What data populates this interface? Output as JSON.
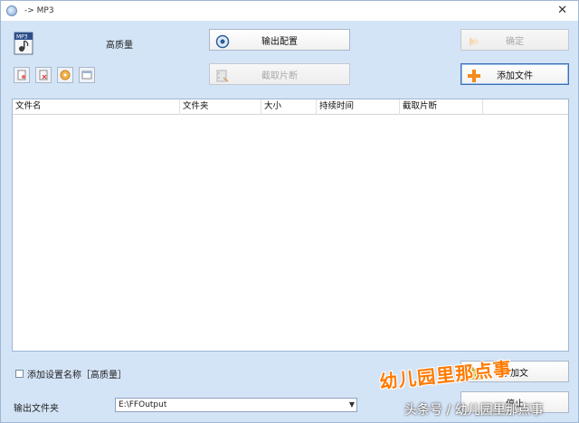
{
  "window": {
    "title": "-> MP3"
  },
  "header": {
    "quality_label": "高质量"
  },
  "buttons": {
    "output_config": "输出配置",
    "ok": "确定",
    "clip": "截取片断",
    "add_file": "添加文件",
    "add_file_bottom": "添加文",
    "stop": "停止"
  },
  "file_list": {
    "columns": [
      "文件名",
      "文件夹",
      "大小",
      "持续时间",
      "截取片断"
    ]
  },
  "options": {
    "add_setting_name_label": "添加设置名称［高质量］"
  },
  "output": {
    "folder_label": "输出文件夹",
    "folder_value": "E:\\FFOutput"
  },
  "watermark": {
    "main": "幼儿园里那点事",
    "sub": "头条号 / 幼儿园里那点事"
  },
  "colors": {
    "window_bg": "#d4e4f7",
    "accent_orange": "#ff7a00",
    "border_blue": "#9fb6d4"
  }
}
